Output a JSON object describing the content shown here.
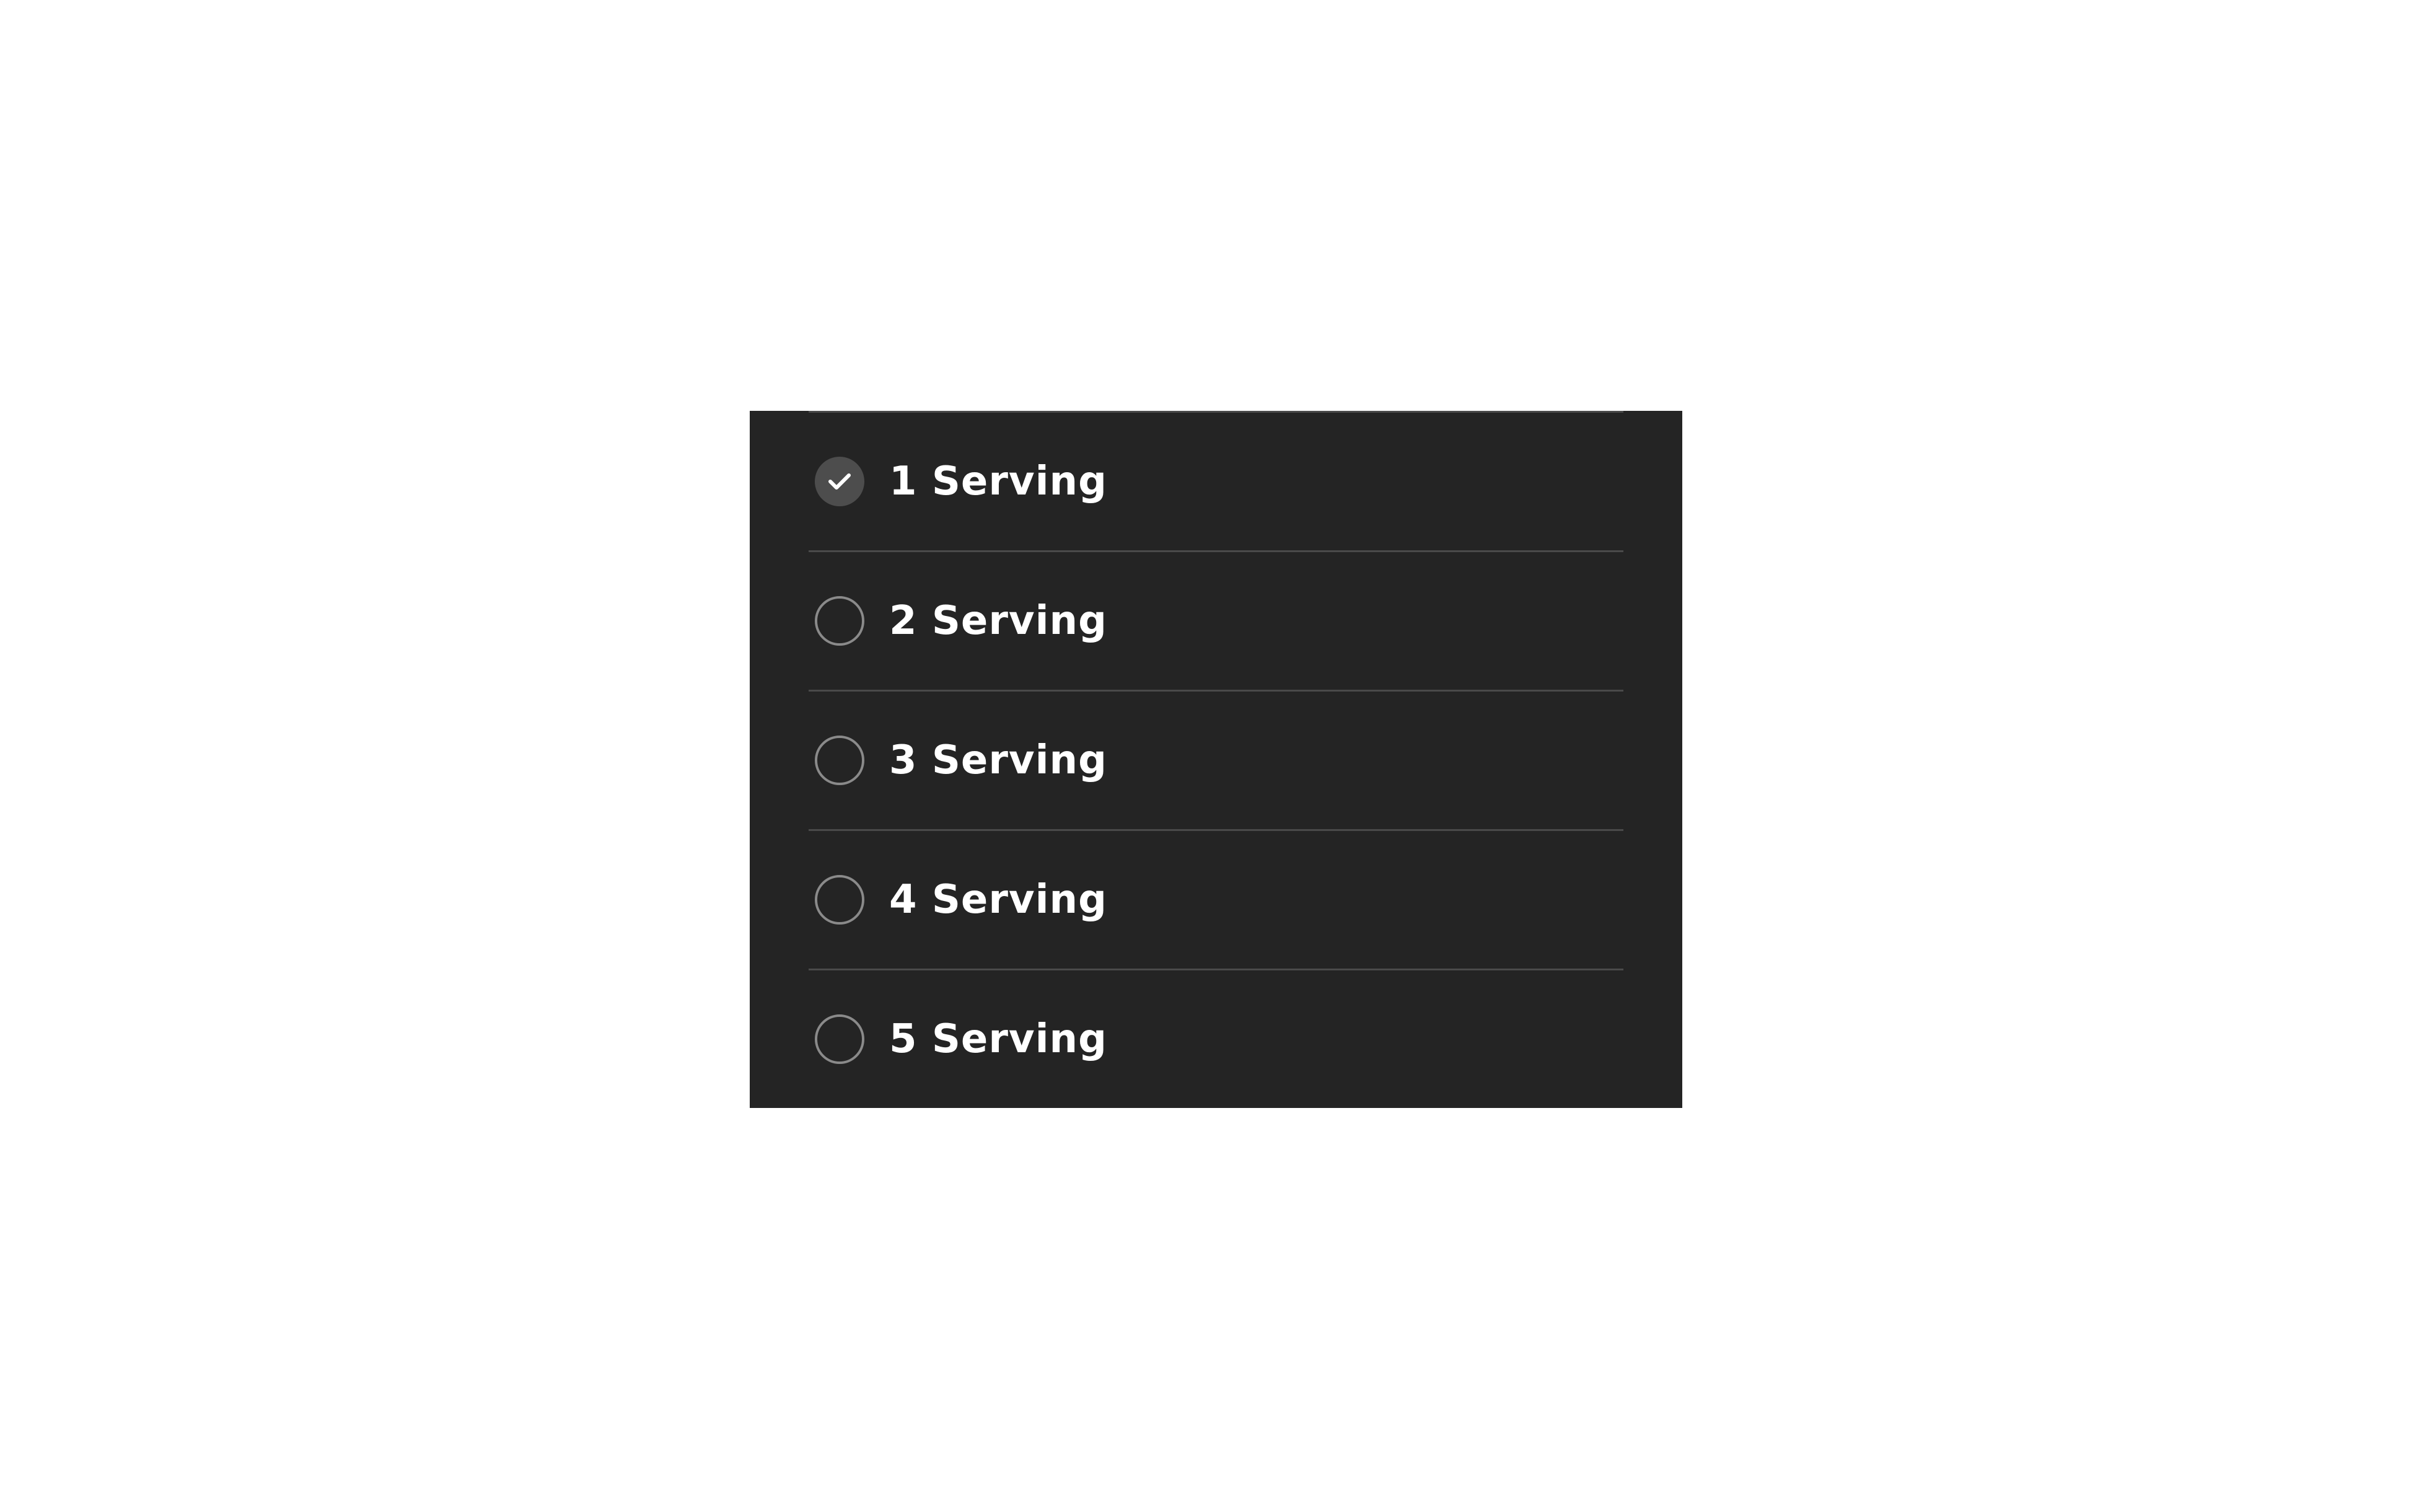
{
  "servings": {
    "options": [
      {
        "label": "1 Serving",
        "checked": true
      },
      {
        "label": "2 Serving",
        "checked": false
      },
      {
        "label": "3 Serving",
        "checked": false
      },
      {
        "label": "4 Serving",
        "checked": false
      },
      {
        "label": "5 Serving",
        "checked": false
      }
    ]
  },
  "icons": {
    "selected": "check-icon",
    "unselected": "radio-empty-icon"
  },
  "colors": {
    "panel_background": "#242424",
    "text": "#ffffff",
    "divider": "#4a4a4a",
    "radio_border": "#8a8a8a",
    "radio_checked_fill": "#4d4d4d"
  }
}
